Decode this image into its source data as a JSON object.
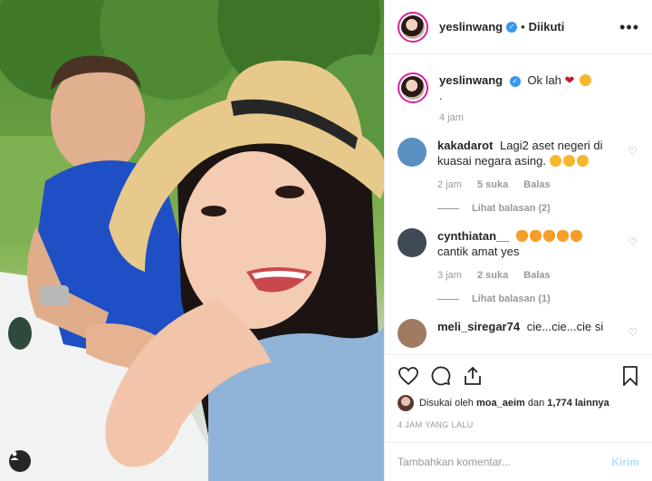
{
  "post": {
    "username": "yeslinwang",
    "follow_state": "Diikuti",
    "more_icon": "more-horizontal-icon",
    "verified_icon": "verified-badge-icon"
  },
  "caption": {
    "username": "yeslinwang",
    "text": "Ok lah",
    "second_line": ".",
    "time": "4 jam"
  },
  "comments": [
    {
      "username": "kakadarot",
      "text": "Lagi2 aset negeri di kuasai negara asing.",
      "time": "2 jam",
      "likes": "5 suka",
      "reply": "Balas",
      "view_replies": "Lihat balasan (2)",
      "avatar_color": "#5a8fbf"
    },
    {
      "username": "cynthiatan__",
      "text": "cantik amat yes",
      "time": "3 jam",
      "likes": "2 suka",
      "reply": "Balas",
      "view_replies": "Lihat balasan (1)",
      "avatar_color": "#3f4a55"
    },
    {
      "username": "meli_siregar74",
      "text": "cie...cie...cie si",
      "avatar_color": "#a07a63"
    }
  ],
  "likes": {
    "prefix": "Disukai oleh",
    "user": "moa_aeim",
    "middle": "dan",
    "count": "1,774 lainnya"
  },
  "timestamp": "4 JAM YANG LALU",
  "add_comment": {
    "placeholder": "Tambahkan komentar...",
    "post_label": "Kirim"
  },
  "colors": {
    "verified": "#3897f0",
    "story_ring": "#d6249f",
    "post_button_disabled": "#b2dffc"
  }
}
